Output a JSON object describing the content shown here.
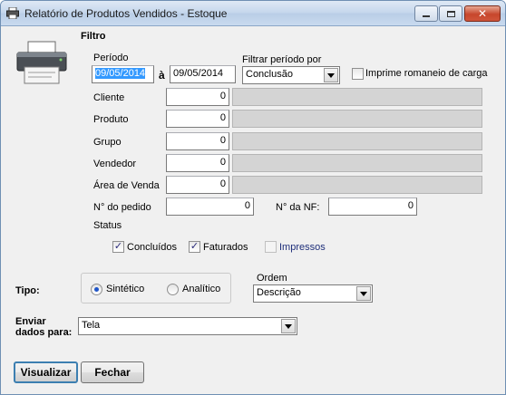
{
  "window": {
    "title": "Relatório de Produtos Vendidos - Estoque",
    "min_icon": "minimize-icon",
    "max_icon": "maximize-icon",
    "close_icon": "close-icon",
    "close_glyph": "✕"
  },
  "filtro": {
    "heading": "Filtro",
    "periodo_label": "Período",
    "date_from": "09/05/2014",
    "date_separator": "à",
    "date_to": "09/05/2014",
    "filtrar_label": "Filtrar período por",
    "filtrar_value": "Conclusão",
    "romaneio_label": "Imprime romaneio de carga",
    "romaneio_checked": false
  },
  "fields": [
    {
      "label": "Cliente",
      "code": "0",
      "desc": ""
    },
    {
      "label": "Produto",
      "code": "0",
      "desc": ""
    },
    {
      "label": "Grupo",
      "code": "0",
      "desc": ""
    },
    {
      "label": "Vendedor",
      "code": "0",
      "desc": ""
    },
    {
      "label": "Área de Venda",
      "code": "0",
      "desc": ""
    }
  ],
  "pedido": {
    "label": "N° do pedido",
    "value": "0"
  },
  "nf": {
    "label": "N° da NF:",
    "value": "0"
  },
  "status": {
    "label": "Status",
    "items": [
      {
        "label": "Concluídos",
        "checked": true,
        "enabled": true
      },
      {
        "label": "Faturados",
        "checked": true,
        "enabled": true
      },
      {
        "label": "Impressos",
        "checked": false,
        "enabled": false
      }
    ],
    "check_glyph": "✓"
  },
  "tipo": {
    "label": "Tipo:",
    "options": [
      "Sintético",
      "Analítico"
    ],
    "selected": "Sintético"
  },
  "ordem": {
    "label": "Ordem",
    "value": "Descrição"
  },
  "enviar": {
    "label_line1": "Enviar",
    "label_line2": "dados para:",
    "value": "Tela"
  },
  "buttons": {
    "visualizar": "Visualizar",
    "fechar": "Fechar"
  },
  "icons": {
    "app": "printer-icon"
  }
}
